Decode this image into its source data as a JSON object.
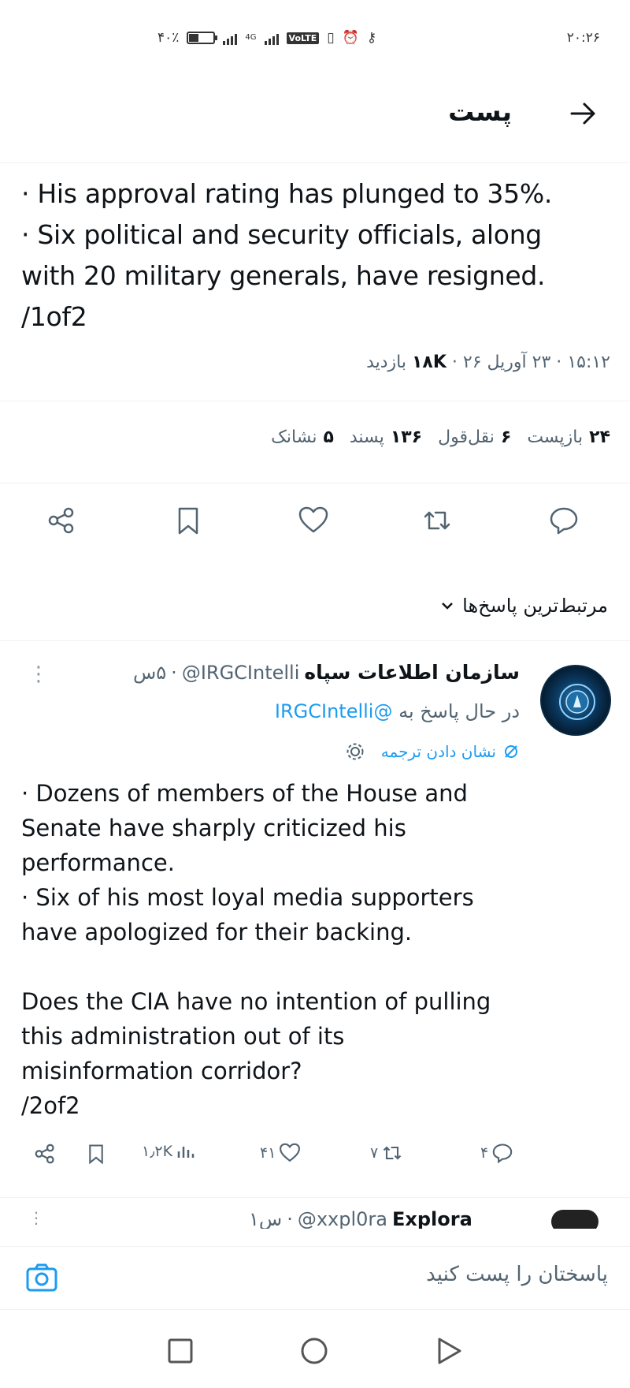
{
  "status_bar": {
    "time": "۲۰:۲۶",
    "battery_percent": "۴۰٪",
    "battery_level": 0.4,
    "network": "4G",
    "volte": "VoLTE"
  },
  "header": {
    "title": "پست"
  },
  "tweet": {
    "lines": [
      "· His approval rating has plunged to 35%.",
      "· Six political and security officials, along",
      "with 20 military generals, have resigned.",
      "/1of2"
    ],
    "time": "۱۵:۱۲",
    "date": "۲۳ آوریل ۲۶",
    "views_count": "۱۸K",
    "views_label": "بازدید",
    "stats": [
      {
        "count": "۲۴",
        "label": "بازپست"
      },
      {
        "count": "۶",
        "label": "نقل‌قول"
      },
      {
        "count": "۱۳۶",
        "label": "پسند"
      },
      {
        "count": "۵",
        "label": "نشانک"
      }
    ]
  },
  "relevant_replies_label": "مرتبط‌ترین پاسخ‌ها",
  "reply": {
    "display_name": "سازمان اطلاعات سپاه",
    "handle": "@IRGCIntelli",
    "age": "۵س",
    "replying_to_label": "در حال پاسخ به",
    "replying_to_handle": "@IRGCIntelli",
    "translate_label": "نشان دادن ترجمه",
    "text": "· Dozens of members of the House and\nSenate have sharply criticized his\nperformance.\n· Six of his most loyal media supporters\nhave apologized for their backing.\n\nDoes the CIA have no intention of pulling\nthis administration out of its\nmisinformation corridor?\n/2of2",
    "replies": "۴",
    "reposts": "۷",
    "likes": "۴۱",
    "views": "۱٫۲K"
  },
  "next_reply": {
    "display_name": "Explora",
    "handle": "@xxpl0ra",
    "age": "۱س"
  },
  "composer": {
    "placeholder": "پاسختان را پست کنید"
  }
}
